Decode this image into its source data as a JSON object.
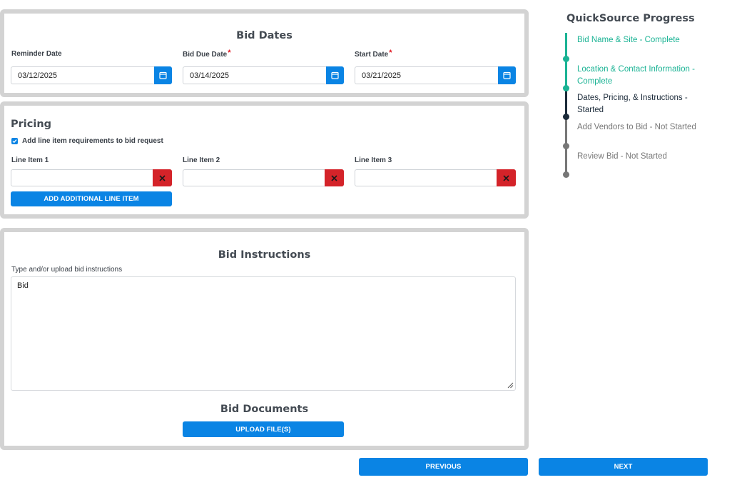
{
  "bid_dates": {
    "title": "Bid Dates",
    "fields": [
      {
        "label": "Reminder Date",
        "required": false,
        "value": "03/12/2025"
      },
      {
        "label": "Bid Due Date",
        "required": true,
        "value": "03/14/2025"
      },
      {
        "label": "Start Date",
        "required": true,
        "value": "03/21/2025"
      }
    ],
    "required_mark": "*"
  },
  "pricing": {
    "title": "Pricing",
    "checkbox_label": "Add line item requirements to bid request",
    "checkbox_checked": true,
    "line_items": [
      {
        "label": "Line Item 1",
        "value": ""
      },
      {
        "label": "Line Item 2",
        "value": ""
      },
      {
        "label": "Line Item 3",
        "value": ""
      }
    ],
    "add_button_label": "ADD ADDITIONAL LINE ITEM"
  },
  "instructions": {
    "title": "Bid Instructions",
    "hint": "Type and/or upload bid instructions",
    "text": "Bid",
    "documents_title": "Bid Documents",
    "upload_button_label": "UPLOAD FILE(S)"
  },
  "nav": {
    "previous_label": "PREVIOUS",
    "next_label": "NEXT"
  },
  "progress": {
    "title": "QuickSource Progress",
    "steps": [
      {
        "text": "Bid Name & Site - Complete",
        "status": "complete"
      },
      {
        "text": "Location & Contact Information - Complete",
        "status": "complete"
      },
      {
        "text": "Dates, Pricing, & Instructions - Started",
        "status": "started"
      },
      {
        "text": "Add Vendors to Bid - Not Started",
        "status": "not-started"
      },
      {
        "text": "Review Bid - Not Started",
        "status": "not-started"
      }
    ]
  },
  "colors": {
    "primary": "#0a84e4",
    "danger": "#d42329",
    "complete": "#1ab394",
    "started": "#1c2b3a",
    "not_started": "#777777",
    "panel_border": "#d3d3d3"
  },
  "icons": {
    "calendar": "calendar-icon",
    "delete": "close-icon",
    "checkbox": "checkbox-icon"
  }
}
